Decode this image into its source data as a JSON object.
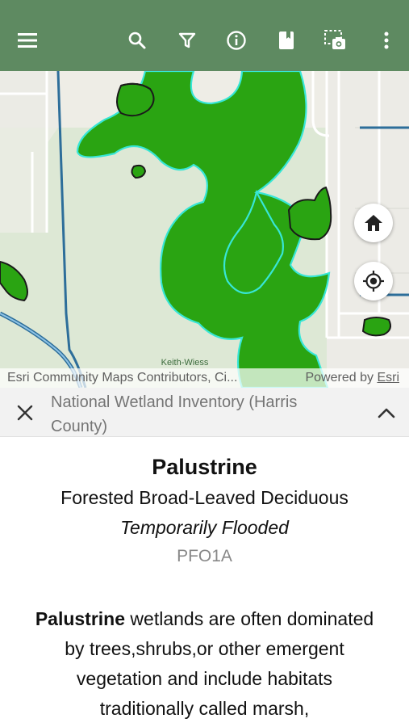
{
  "toolbar": {
    "menu_icon": "hamburger-menu-icon",
    "search_icon": "search-icon",
    "filter_icon": "filter-icon",
    "info_icon": "info-icon",
    "bookmark_icon": "bookmark-icon",
    "screenshot_icon": "map-screenshot-icon",
    "more_icon": "more-vertical-icon",
    "background_color": "#5e8a61"
  },
  "map": {
    "road_label": "Keith-Wiess",
    "home_button_icon": "home-icon",
    "locate_button_icon": "gps-locate-icon",
    "wetland_fill_color": "#2aa412",
    "selected_outline_color": "#37e6d6",
    "attribution": {
      "sources": "Esri Community Maps Contributors, Ci...",
      "powered_by": "Powered by",
      "brand": "Esri"
    }
  },
  "popup": {
    "layer_name": "National Wetland Inventory (Harris County)",
    "close_icon": "close-icon",
    "collapse_icon": "chevron-up-icon",
    "system": "Palustrine",
    "class": "Forested Broad-Leaved Deciduous",
    "regime": "Temporarily Flooded",
    "code": "PFO1A",
    "description_term": "Palustrine",
    "description_text": " wetlands are often dominated by trees,shrubs,or other emergent vegetation and include habitats traditionally called marsh,"
  }
}
